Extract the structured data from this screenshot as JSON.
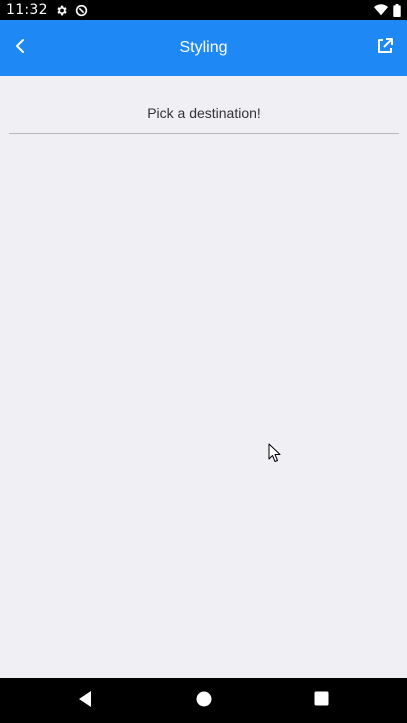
{
  "status_bar": {
    "time": "11:32",
    "icons": [
      "gear-icon",
      "data-saver-icon",
      "wifi-icon",
      "battery-icon"
    ]
  },
  "app_bar": {
    "title": "Styling",
    "back_icon": "chevron-left-icon",
    "action_icon": "open-external-icon",
    "background": "#1e88f5"
  },
  "picker": {
    "placeholder": "Pick a destination!"
  },
  "nav_bar": {
    "buttons": [
      "back-triangle-icon",
      "home-circle-icon",
      "recents-square-icon"
    ]
  },
  "colors": {
    "accent": "#1e88f5",
    "page_background": "#efeff4"
  }
}
